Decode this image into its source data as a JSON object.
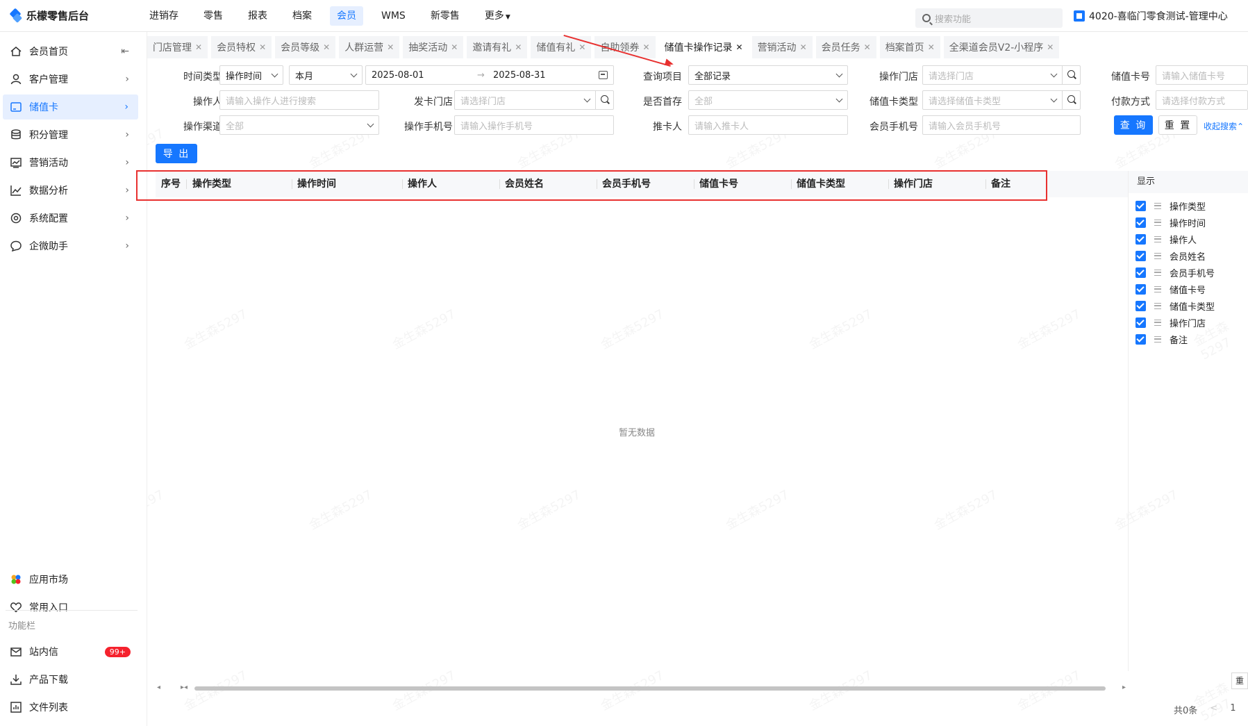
{
  "app": {
    "title": "乐檬零售后台"
  },
  "topnav": [
    "进销存",
    "零售",
    "报表",
    "档案",
    "会员",
    "WMS",
    "新零售",
    "更多"
  ],
  "topnav_active": 4,
  "search": {
    "placeholder": "搜索功能"
  },
  "org": {
    "name": "4020-喜临门零食测试-管理中心"
  },
  "sidebar": {
    "items": [
      {
        "label": "会员首页",
        "icon": "home-icon"
      },
      {
        "label": "客户管理",
        "icon": "user-icon"
      },
      {
        "label": "储值卡",
        "icon": "card-icon"
      },
      {
        "label": "积分管理",
        "icon": "coins-icon"
      },
      {
        "label": "营销活动",
        "icon": "campaign-icon"
      },
      {
        "label": "数据分析",
        "icon": "chart-icon"
      },
      {
        "label": "系统配置",
        "icon": "settings-icon"
      },
      {
        "label": "企微助手",
        "icon": "chat-icon"
      }
    ],
    "active": 2,
    "bottom": [
      {
        "label": "应用市场",
        "icon": "app-market-icon"
      },
      {
        "label": "常用入口",
        "icon": "heart-icon"
      }
    ],
    "caption": "功能栏",
    "tools": [
      {
        "label": "站内信",
        "icon": "mail-icon",
        "badge": "99+"
      },
      {
        "label": "产品下载",
        "icon": "download-icon"
      },
      {
        "label": "文件列表",
        "icon": "file-list-icon"
      }
    ]
  },
  "tabs": [
    "门店管理",
    "会员特权",
    "会员等级",
    "人群运营",
    "抽奖活动",
    "邀请有礼",
    "储值有礼",
    "自助领券",
    "储值卡操作记录",
    "营销活动",
    "会员任务",
    "档案首页",
    "全渠道会员V2-小程序"
  ],
  "tabs_active": 8,
  "filters": {
    "time_type": {
      "label": "时间类型",
      "value": "操作时间"
    },
    "period": {
      "value": "本月"
    },
    "date_start": "2025-08-01",
    "date_end": "2025-08-31",
    "date_sep": "→",
    "query_item": {
      "label": "查询项目",
      "value": "全部记录"
    },
    "store": {
      "label": "操作门店",
      "placeholder": "请选择门店"
    },
    "card_no": {
      "label": "储值卡号",
      "placeholder": "请输入储值卡号"
    },
    "operator": {
      "label": "操作人",
      "placeholder": "请输入操作人进行搜索"
    },
    "issue_store": {
      "label": "发卡门店",
      "placeholder": "请选择门店"
    },
    "first_deposit": {
      "label": "是否首存",
      "value": "全部"
    },
    "card_type": {
      "label": "储值卡类型",
      "placeholder": "请选择储值卡类型"
    },
    "pay_method": {
      "label": "付款方式",
      "placeholder": "请选择付款方式"
    },
    "channel": {
      "label": "操作渠道",
      "value": "全部"
    },
    "operator_phone": {
      "label": "操作手机号",
      "placeholder": "请输入操作手机号"
    },
    "referrer": {
      "label": "推卡人",
      "placeholder": "请输入推卡人"
    },
    "member_phone": {
      "label": "会员手机号",
      "placeholder": "请输入会员手机号"
    }
  },
  "actions": {
    "query": "查 询",
    "reset": "重 置",
    "collapse": "收起搜索",
    "export": "导 出"
  },
  "table": {
    "columns": [
      "序号",
      "操作类型",
      "操作时间",
      "操作人",
      "会员姓名",
      "会员手机号",
      "储值卡号",
      "储值卡类型",
      "操作门店",
      "备注"
    ],
    "empty": "暂无数据"
  },
  "column_panel": {
    "title": "显示",
    "items": [
      "操作类型",
      "操作时间",
      "操作人",
      "会员姓名",
      "会员手机号",
      "储值卡号",
      "储值卡类型",
      "操作门店",
      "备注"
    ],
    "reset_short": "重"
  },
  "pagination": {
    "total": "共0条",
    "prev": "<",
    "page": "1"
  },
  "watermark": "金生森5297",
  "colors": {
    "primary": "#1677ff",
    "annotation": "#e8302f"
  }
}
